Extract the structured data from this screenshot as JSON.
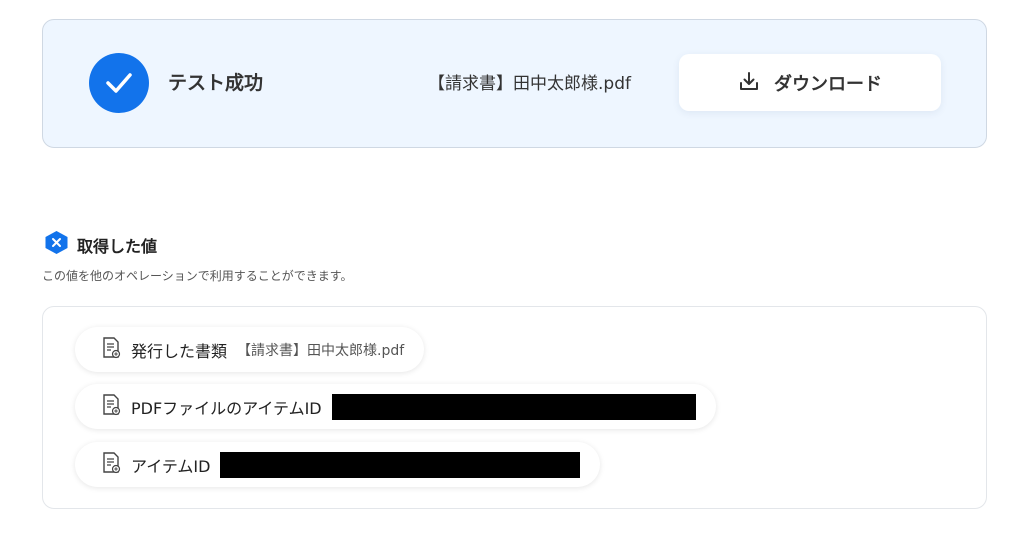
{
  "result": {
    "status_text": "テスト成功",
    "file_name": "【請求書】田中太郎様.pdf",
    "download_label": "ダウンロード"
  },
  "section": {
    "title": "取得した値",
    "description": "この値を他のオペレーションで利用することができます。"
  },
  "values": [
    {
      "label": "発行した書類",
      "value": "【請求書】田中太郎様.pdf",
      "redacted": false
    },
    {
      "label": "PDFファイルのアイテムID",
      "value": "",
      "redacted": true
    },
    {
      "label": "アイテムID",
      "value": "",
      "redacted": true
    }
  ],
  "colors": {
    "accent": "#1273eb",
    "card_bg": "#eef6ff"
  }
}
